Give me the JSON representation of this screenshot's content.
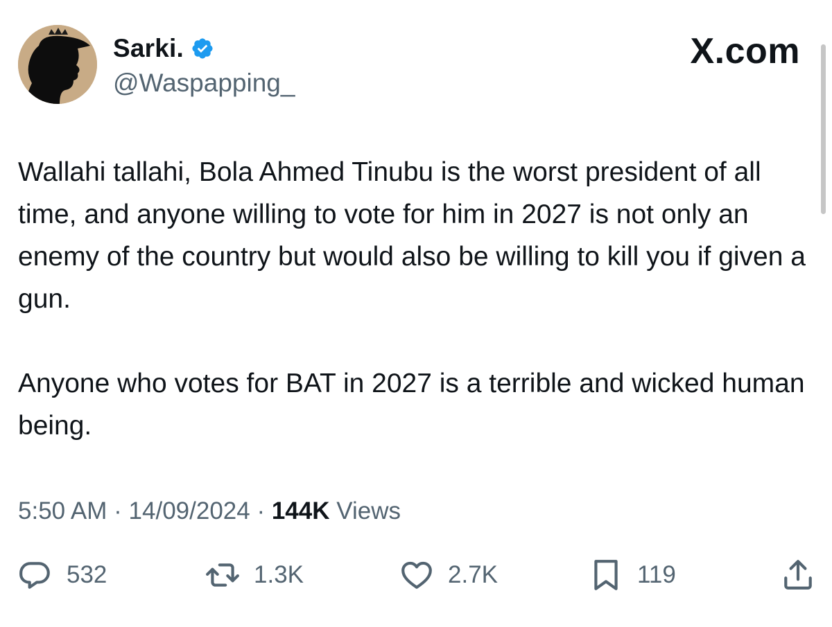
{
  "tweet": {
    "author": {
      "display_name": "Sarki.",
      "handle": "@Waspapping_",
      "verified": true
    },
    "brand": "X.com",
    "text_paragraphs": [
      "Wallahi tallahi, Bola Ahmed Tinubu is the worst president of all time, and anyone willing to vote for him in 2027 is not only an enemy of the country but would also be willing to kill you if given a gun.",
      "Anyone who votes for BAT in 2027 is a terrible and wicked human being."
    ],
    "meta": {
      "time": "5:50 AM",
      "separator": "·",
      "date": "14/09/2024",
      "views_count": "144K",
      "views_label": "Views"
    },
    "actions": {
      "replies": "532",
      "reposts": "1.3K",
      "likes": "2.7K",
      "bookmarks": "119"
    }
  },
  "icons": {
    "verified": "verified-badge-icon",
    "reply": "reply-icon",
    "repost": "repost-icon",
    "like": "heart-icon",
    "bookmark": "bookmark-icon",
    "share": "share-icon"
  },
  "colors": {
    "text": "#0f1419",
    "secondary": "#536471",
    "verified": "#1d9bf0",
    "avatar_bg": "#c8ab86"
  }
}
